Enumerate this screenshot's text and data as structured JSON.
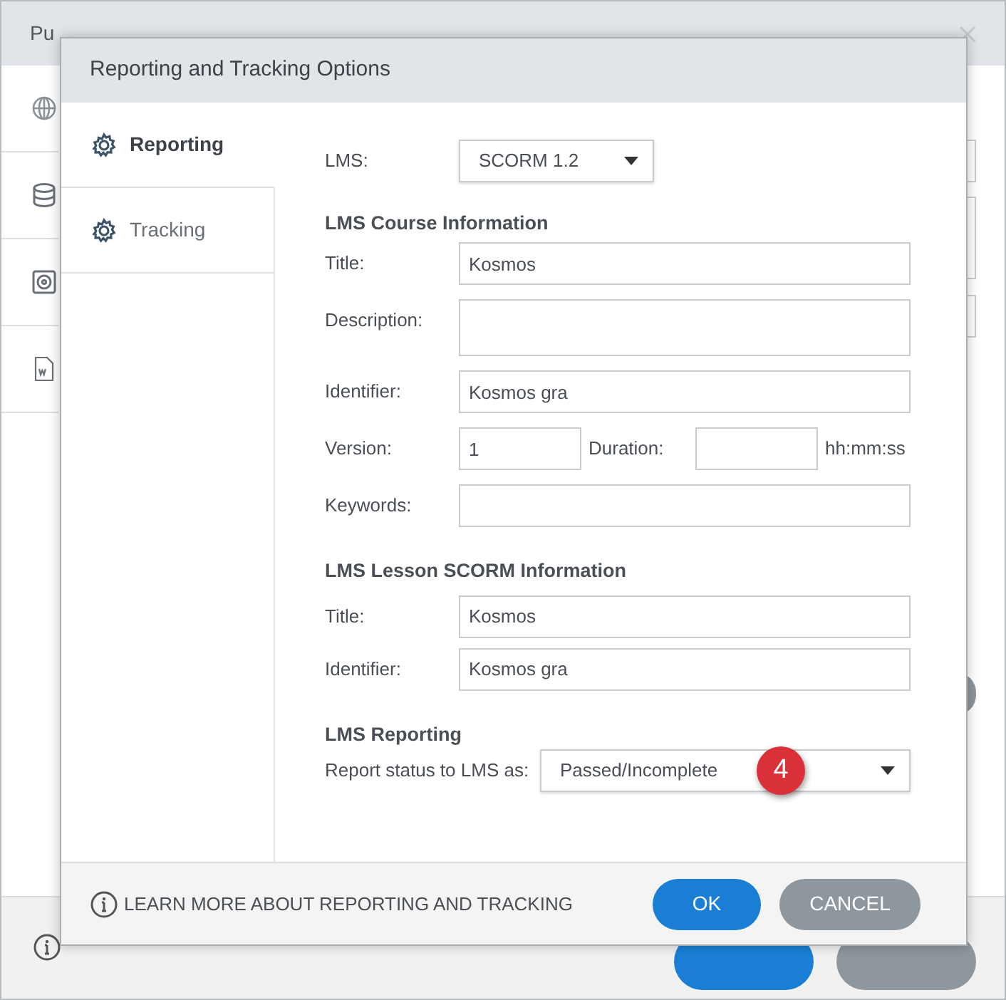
{
  "background_window": {
    "title": "Pu"
  },
  "dialog": {
    "title": "Reporting and Tracking Options",
    "tabs": [
      {
        "label": "Reporting",
        "selected": true
      },
      {
        "label": "Tracking",
        "selected": false
      }
    ],
    "lms": {
      "label": "LMS:",
      "value": "SCORM 1.2"
    },
    "course_heading": "LMS Course Information",
    "course_fields": [
      {
        "kind": "text",
        "label": "Title:",
        "value": "Kosmos"
      },
      {
        "kind": "textarea",
        "label": "Description:"
      },
      {
        "kind": "text",
        "label": "Identifier:",
        "value": "Kosmos gra"
      },
      {
        "kind": "version",
        "label": "Version:",
        "value": "1",
        "duration_label": "Duration:",
        "duration_unit": "hh:mm:ss"
      },
      {
        "kind": "text",
        "label": "Keywords:"
      }
    ],
    "lesson_heading": "LMS Lesson SCORM Information",
    "lesson_fields": [
      {
        "kind": "text",
        "label": "Title:",
        "value": "Kosmos"
      },
      {
        "kind": "text",
        "label": "Identifier:",
        "value": "Kosmos gra"
      }
    ],
    "reporting_heading": "LMS Reporting",
    "report_status": {
      "label": "Report status to LMS as:",
      "value": "Passed/Incomplete",
      "callout": "4"
    },
    "footer": {
      "link": "LEARN MORE ABOUT REPORTING AND TRACKING",
      "buttons": [
        {
          "kind": "primary",
          "label": "OK"
        },
        {
          "kind": "secondary",
          "label": "CANCEL"
        }
      ]
    }
  }
}
